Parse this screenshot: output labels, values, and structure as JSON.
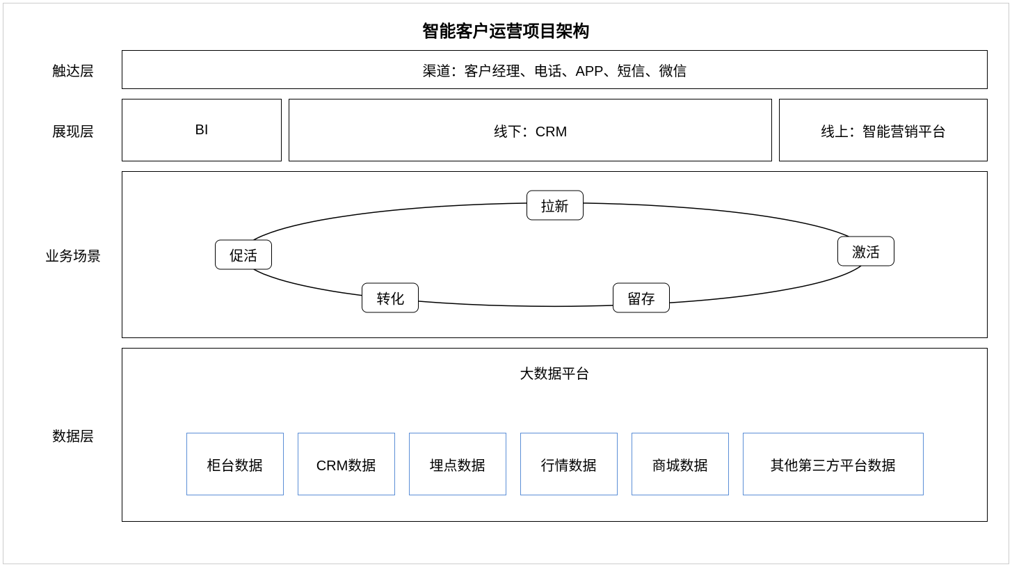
{
  "title": "智能客户运营项目架构",
  "layers": {
    "touch": {
      "label": "触达层",
      "content": "渠道：客户经理、电话、APP、短信、微信"
    },
    "display": {
      "label": "展现层",
      "items": [
        "BI",
        "线下：CRM",
        "线上：智能营销平台"
      ]
    },
    "scenario": {
      "label": "业务场景",
      "nodes": {
        "top": "拉新",
        "left": "促活",
        "right": "激活",
        "bottomLeft": "转化",
        "bottomRight": "留存"
      }
    },
    "data": {
      "label": "数据层",
      "platformTitle": "大数据平台",
      "sources": [
        "柜台数据",
        "CRM数据",
        "埋点数据",
        "行情数据",
        "商城数据",
        "其他第三方平台数据"
      ]
    }
  }
}
